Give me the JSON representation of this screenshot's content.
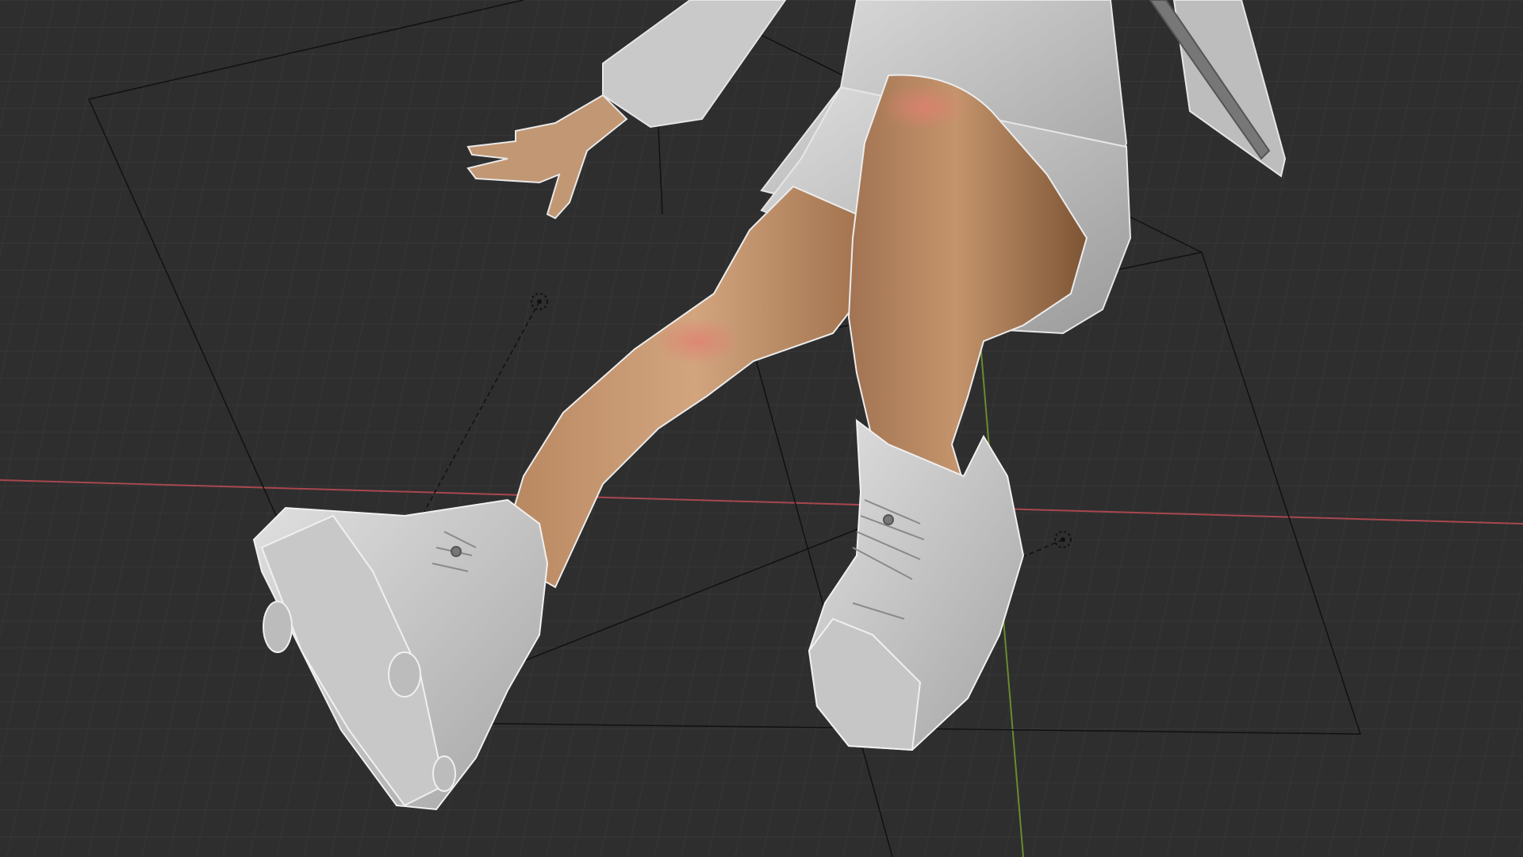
{
  "app": "3D viewport",
  "viewport": {
    "background": "#303030",
    "grid_color": "#3a3a3a",
    "x_axis_color": "#a8474f",
    "y_axis_color": "#6b8a2f",
    "shading": "solid",
    "overlays": "visible",
    "selection_outline": "#d8d8d8"
  },
  "scene": {
    "subject": "character-legs-with-sneakers",
    "objects": [
      {
        "name": "character-body",
        "selected": true
      },
      {
        "name": "left-sneaker",
        "selected": true
      },
      {
        "name": "right-sneaker",
        "selected": true
      },
      {
        "name": "hoodie",
        "selected": true
      }
    ],
    "ik_targets": [
      "foot-ik-target-left",
      "foot-ik-target-right"
    ]
  },
  "colors": {
    "skin": "#c79b75",
    "skin_shadow": "#8a5f3e",
    "knee_blush": "#d97a6b",
    "cloth": "#d3d3d3",
    "cloth_shadow": "#8f8f8f"
  }
}
